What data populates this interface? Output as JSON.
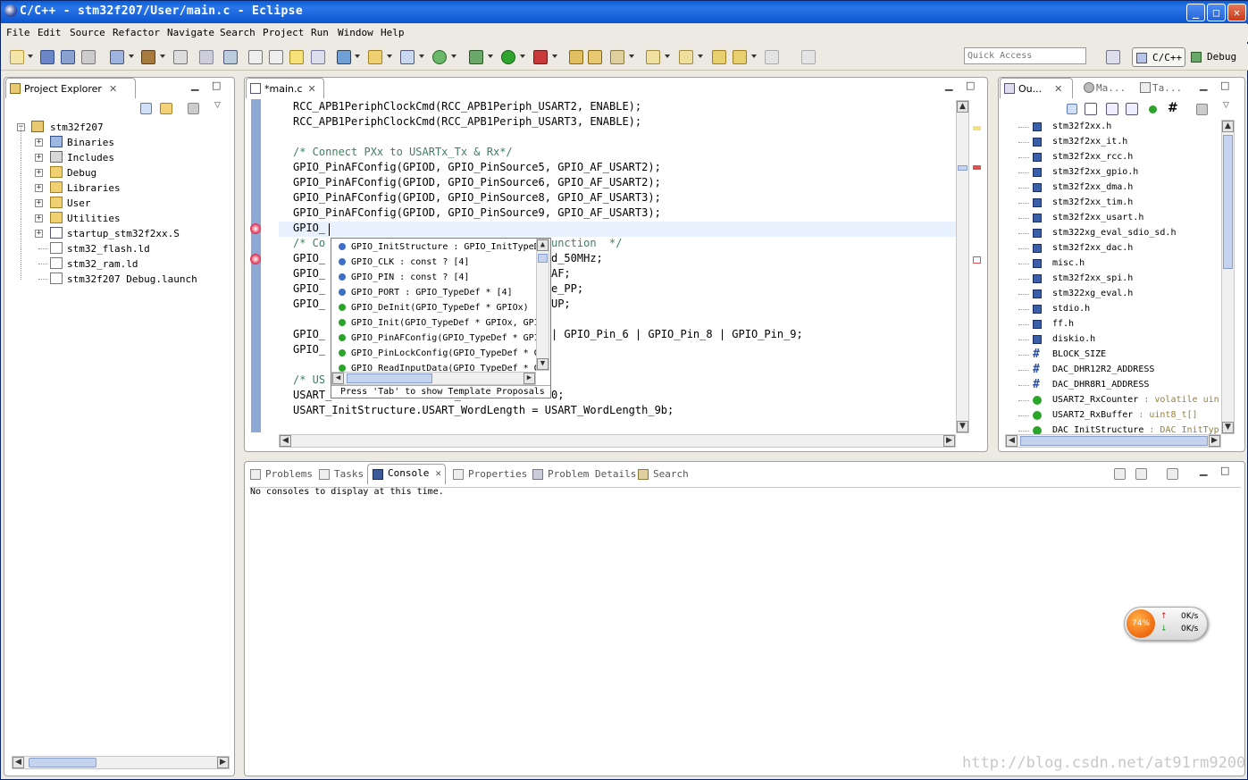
{
  "window": {
    "title": "C/C++ - stm32f207/User/main.c - Eclipse",
    "min": "_",
    "max": "□",
    "close": "✕"
  },
  "menu": [
    "File",
    "Edit",
    "Source",
    "Refactor",
    "Navigate",
    "Search",
    "Project",
    "Run",
    "Window",
    "Help"
  ],
  "toolbar": {
    "quick_access_placeholder": "Quick Access",
    "persp_cc": "C/C++",
    "persp_debug": "Debug"
  },
  "project_explorer": {
    "tab": "Project Explorer",
    "root": "stm32f207",
    "items": [
      {
        "label": "Binaries",
        "expandable": true,
        "icon": "binaries-icon"
      },
      {
        "label": "Includes",
        "expandable": true,
        "icon": "includes-icon"
      },
      {
        "label": "Debug",
        "expandable": true,
        "icon": "folder-icon"
      },
      {
        "label": "Libraries",
        "expandable": true,
        "icon": "folder-icon"
      },
      {
        "label": "User",
        "expandable": true,
        "icon": "folder-icon"
      },
      {
        "label": "Utilities",
        "expandable": true,
        "icon": "folder-icon"
      },
      {
        "label": "startup_stm32f2xx.S",
        "expandable": true,
        "icon": "asm-file-icon"
      },
      {
        "label": "stm32_flash.ld",
        "expandable": false,
        "icon": "file-icon"
      },
      {
        "label": "stm32_ram.ld",
        "expandable": false,
        "icon": "file-icon"
      },
      {
        "label": "stm32f207 Debug.launch",
        "expandable": false,
        "icon": "file-icon"
      }
    ]
  },
  "editor": {
    "tab": "*main.c",
    "lines": [
      "RCC_APB1PeriphClockCmd(RCC_APB1Periph_USART2, ENABLE);",
      "RCC_APB1PeriphClockCmd(RCC_APB1Periph_USART3, ENABLE);",
      "",
      "/* Connect PXx to USARTx_Tx & Rx*/",
      "GPIO_PinAFConfig(GPIOD, GPIO_PinSource5, GPIO_AF_USART2);",
      "GPIO_PinAFConfig(GPIOD, GPIO_PinSource6, GPIO_AF_USART2);",
      "GPIO_PinAFConfig(GPIOD, GPIO_PinSource8, GPIO_AF_USART3);",
      "GPIO_PinAFConfig(GPIOD, GPIO_PinSource9, GPIO_AF_USART3);",
      "GPIO_",
      "/* Co                               te function  */",
      "GPIO_                              _Speed_50MHz;",
      "GPIO_                              Mode_AF;",
      "GPIO_                              _OType_PP;",
      "GPIO_                              PuPd_UP;",
      "",
      "GPIO_                              in_5 | GPIO_Pin_6 | GPIO_Pin_8 | GPIO_Pin_9;",
      "GPIO_                              );",
      "",
      "/* US",
      "USART_InitStructure.USART_BaudRate = 9600;",
      "USART_InitStructure.USART_WordLength = USART_WordLength_9b;"
    ]
  },
  "autocomplete": {
    "items": [
      {
        "text": "GPIO_InitStructure : GPIO_InitTypeDef",
        "color": "#3d6fc7"
      },
      {
        "text": "GPIO_CLK : const ? [4]",
        "color": "#3d6fc7"
      },
      {
        "text": "GPIO_PIN : const ? [4]",
        "color": "#3d6fc7"
      },
      {
        "text": "GPIO_PORT : GPIO_TypeDef * [4]",
        "color": "#3d6fc7"
      },
      {
        "text": "GPIO_DeInit(GPIO_TypeDef * GPIOx)",
        "color": "#2aa52a"
      },
      {
        "text": "GPIO_Init(GPIO_TypeDef * GPIOx, GPIO",
        "color": "#2aa52a"
      },
      {
        "text": "GPIO_PinAFConfig(GPIO_TypeDef * GPI",
        "color": "#2aa52a"
      },
      {
        "text": "GPIO_PinLockConfig(GPIO_TypeDef * G",
        "color": "#2aa52a"
      },
      {
        "text": "GPIO_ReadInputData(GPIO_TypeDef * G",
        "color": "#2aa52a"
      }
    ],
    "footer": "Press 'Tab' to show Template Proposals"
  },
  "outline": {
    "tabs": [
      "Ou...",
      "Ma...",
      "Ta..."
    ],
    "items": [
      {
        "label": "stm32f2xx.h",
        "type": "",
        "icon": "include-icon"
      },
      {
        "label": "stm32f2xx_it.h",
        "type": "",
        "icon": "include-icon"
      },
      {
        "label": "stm32f2xx_rcc.h",
        "type": "",
        "icon": "include-icon"
      },
      {
        "label": "stm32f2xx_gpio.h",
        "type": "",
        "icon": "include-icon"
      },
      {
        "label": "stm32f2xx_dma.h",
        "type": "",
        "icon": "include-icon"
      },
      {
        "label": "stm32f2xx_tim.h",
        "type": "",
        "icon": "include-icon"
      },
      {
        "label": "stm32f2xx_usart.h",
        "type": "",
        "icon": "include-icon"
      },
      {
        "label": "stm322xg_eval_sdio_sd.h",
        "type": "",
        "icon": "include-icon"
      },
      {
        "label": "stm32f2xx_dac.h",
        "type": "",
        "icon": "include-icon"
      },
      {
        "label": "misc.h",
        "type": "",
        "icon": "include-icon"
      },
      {
        "label": "stm32f2xx_spi.h",
        "type": "",
        "icon": "include-icon"
      },
      {
        "label": "stm322xg_eval.h",
        "type": "",
        "icon": "include-icon"
      },
      {
        "label": "stdio.h",
        "type": "",
        "icon": "include-icon"
      },
      {
        "label": "ff.h",
        "type": "",
        "icon": "include-icon"
      },
      {
        "label": "diskio.h",
        "type": "",
        "icon": "include-icon"
      },
      {
        "label": "BLOCK_SIZE",
        "type": "",
        "icon": "macro-icon"
      },
      {
        "label": "DAC_DHR12R2_ADDRESS",
        "type": "",
        "icon": "macro-icon"
      },
      {
        "label": "DAC_DHR8R1_ADDRESS",
        "type": "",
        "icon": "macro-icon"
      },
      {
        "label": "USART2_RxCounter",
        "type": " : volatile uin",
        "icon": "variable-icon"
      },
      {
        "label": "USART2_RxBuffer",
        "type": " : uint8_t[]",
        "icon": "variable-icon"
      },
      {
        "label": "DAC_InitStructure",
        "type": " : DAC_InitTyp",
        "icon": "variable-icon"
      }
    ]
  },
  "bottom": {
    "tabs": [
      "Problems",
      "Tasks",
      "Console",
      "Properties",
      "Problem Details",
      "Search"
    ],
    "active": "Console",
    "message": "No consoles to display at this time."
  },
  "net_widget": {
    "percent": "74%",
    "up": "0K/s",
    "down": "0K/s"
  },
  "watermark": "http://blog.csdn.net/at91rm9200"
}
